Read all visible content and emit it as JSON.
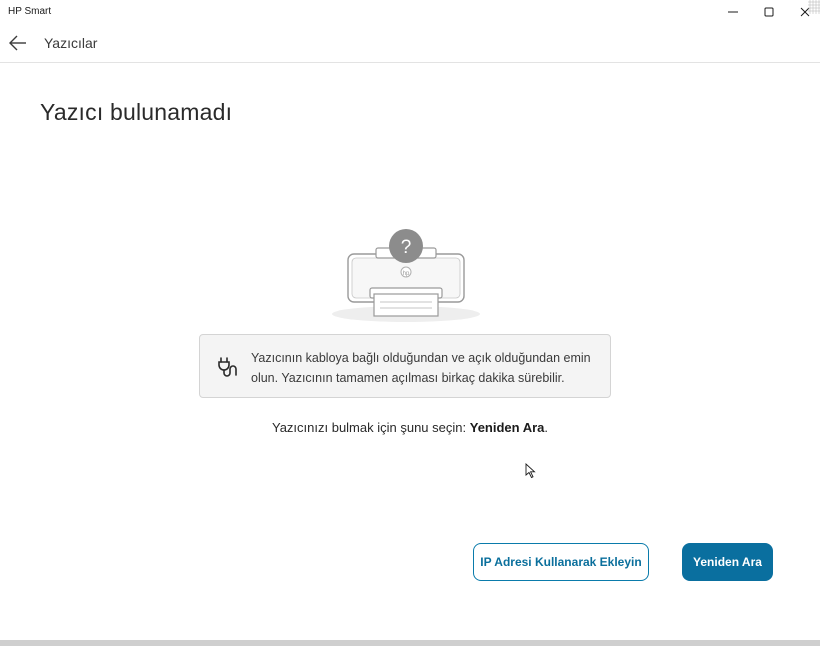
{
  "window": {
    "app_title": "HP Smart"
  },
  "nav": {
    "title": "Yazıcılar"
  },
  "page": {
    "title": "Yazıcı bulunamadı"
  },
  "info": {
    "icon": "plug-icon",
    "text": "Yazıcının kabloya bağlı olduğundan ve açık olduğundan emin olun. Yazıcının tamamen açılması birkaç dakika sürebilir."
  },
  "hint": {
    "prefix": "Yazıcınızı bulmak için şunu seçin:",
    "action": "Yeniden Ara",
    "suffix": "."
  },
  "buttons": {
    "add_by_ip": "IP Adresi Kullanarak Ekleyin",
    "search_again": "Yeniden Ara"
  },
  "illustration": {
    "badge": "?"
  },
  "colors": {
    "primary": "#0a6f9f",
    "outline": "#0a7bab",
    "info_bg": "#f4f4f4"
  }
}
